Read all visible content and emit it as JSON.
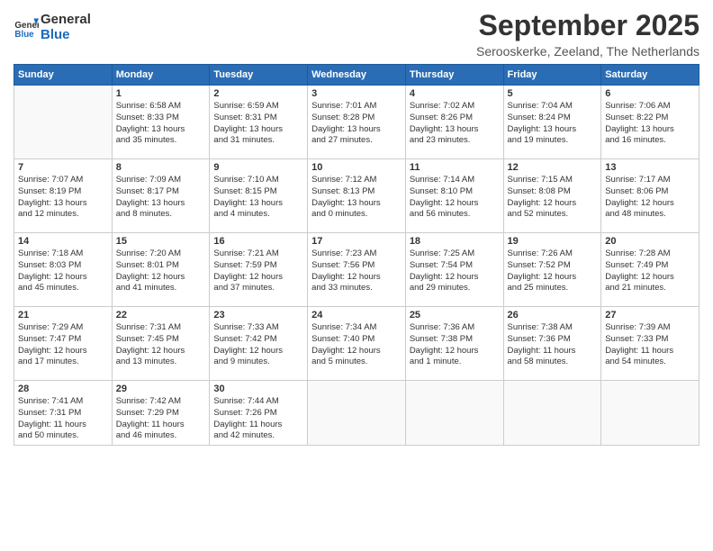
{
  "logo": {
    "line1": "General",
    "line2": "Blue"
  },
  "title": "September 2025",
  "subtitle": "Serooskerke, Zeeland, The Netherlands",
  "days_of_week": [
    "Sunday",
    "Monday",
    "Tuesday",
    "Wednesday",
    "Thursday",
    "Friday",
    "Saturday"
  ],
  "weeks": [
    [
      {
        "day": "",
        "info": ""
      },
      {
        "day": "1",
        "info": "Sunrise: 6:58 AM\nSunset: 8:33 PM\nDaylight: 13 hours\nand 35 minutes."
      },
      {
        "day": "2",
        "info": "Sunrise: 6:59 AM\nSunset: 8:31 PM\nDaylight: 13 hours\nand 31 minutes."
      },
      {
        "day": "3",
        "info": "Sunrise: 7:01 AM\nSunset: 8:28 PM\nDaylight: 13 hours\nand 27 minutes."
      },
      {
        "day": "4",
        "info": "Sunrise: 7:02 AM\nSunset: 8:26 PM\nDaylight: 13 hours\nand 23 minutes."
      },
      {
        "day": "5",
        "info": "Sunrise: 7:04 AM\nSunset: 8:24 PM\nDaylight: 13 hours\nand 19 minutes."
      },
      {
        "day": "6",
        "info": "Sunrise: 7:06 AM\nSunset: 8:22 PM\nDaylight: 13 hours\nand 16 minutes."
      }
    ],
    [
      {
        "day": "7",
        "info": "Sunrise: 7:07 AM\nSunset: 8:19 PM\nDaylight: 13 hours\nand 12 minutes."
      },
      {
        "day": "8",
        "info": "Sunrise: 7:09 AM\nSunset: 8:17 PM\nDaylight: 13 hours\nand 8 minutes."
      },
      {
        "day": "9",
        "info": "Sunrise: 7:10 AM\nSunset: 8:15 PM\nDaylight: 13 hours\nand 4 minutes."
      },
      {
        "day": "10",
        "info": "Sunrise: 7:12 AM\nSunset: 8:13 PM\nDaylight: 13 hours\nand 0 minutes."
      },
      {
        "day": "11",
        "info": "Sunrise: 7:14 AM\nSunset: 8:10 PM\nDaylight: 12 hours\nand 56 minutes."
      },
      {
        "day": "12",
        "info": "Sunrise: 7:15 AM\nSunset: 8:08 PM\nDaylight: 12 hours\nand 52 minutes."
      },
      {
        "day": "13",
        "info": "Sunrise: 7:17 AM\nSunset: 8:06 PM\nDaylight: 12 hours\nand 48 minutes."
      }
    ],
    [
      {
        "day": "14",
        "info": "Sunrise: 7:18 AM\nSunset: 8:03 PM\nDaylight: 12 hours\nand 45 minutes."
      },
      {
        "day": "15",
        "info": "Sunrise: 7:20 AM\nSunset: 8:01 PM\nDaylight: 12 hours\nand 41 minutes."
      },
      {
        "day": "16",
        "info": "Sunrise: 7:21 AM\nSunset: 7:59 PM\nDaylight: 12 hours\nand 37 minutes."
      },
      {
        "day": "17",
        "info": "Sunrise: 7:23 AM\nSunset: 7:56 PM\nDaylight: 12 hours\nand 33 minutes."
      },
      {
        "day": "18",
        "info": "Sunrise: 7:25 AM\nSunset: 7:54 PM\nDaylight: 12 hours\nand 29 minutes."
      },
      {
        "day": "19",
        "info": "Sunrise: 7:26 AM\nSunset: 7:52 PM\nDaylight: 12 hours\nand 25 minutes."
      },
      {
        "day": "20",
        "info": "Sunrise: 7:28 AM\nSunset: 7:49 PM\nDaylight: 12 hours\nand 21 minutes."
      }
    ],
    [
      {
        "day": "21",
        "info": "Sunrise: 7:29 AM\nSunset: 7:47 PM\nDaylight: 12 hours\nand 17 minutes."
      },
      {
        "day": "22",
        "info": "Sunrise: 7:31 AM\nSunset: 7:45 PM\nDaylight: 12 hours\nand 13 minutes."
      },
      {
        "day": "23",
        "info": "Sunrise: 7:33 AM\nSunset: 7:42 PM\nDaylight: 12 hours\nand 9 minutes."
      },
      {
        "day": "24",
        "info": "Sunrise: 7:34 AM\nSunset: 7:40 PM\nDaylight: 12 hours\nand 5 minutes."
      },
      {
        "day": "25",
        "info": "Sunrise: 7:36 AM\nSunset: 7:38 PM\nDaylight: 12 hours\nand 1 minute."
      },
      {
        "day": "26",
        "info": "Sunrise: 7:38 AM\nSunset: 7:36 PM\nDaylight: 11 hours\nand 58 minutes."
      },
      {
        "day": "27",
        "info": "Sunrise: 7:39 AM\nSunset: 7:33 PM\nDaylight: 11 hours\nand 54 minutes."
      }
    ],
    [
      {
        "day": "28",
        "info": "Sunrise: 7:41 AM\nSunset: 7:31 PM\nDaylight: 11 hours\nand 50 minutes."
      },
      {
        "day": "29",
        "info": "Sunrise: 7:42 AM\nSunset: 7:29 PM\nDaylight: 11 hours\nand 46 minutes."
      },
      {
        "day": "30",
        "info": "Sunrise: 7:44 AM\nSunset: 7:26 PM\nDaylight: 11 hours\nand 42 minutes."
      },
      {
        "day": "",
        "info": ""
      },
      {
        "day": "",
        "info": ""
      },
      {
        "day": "",
        "info": ""
      },
      {
        "day": "",
        "info": ""
      }
    ]
  ]
}
